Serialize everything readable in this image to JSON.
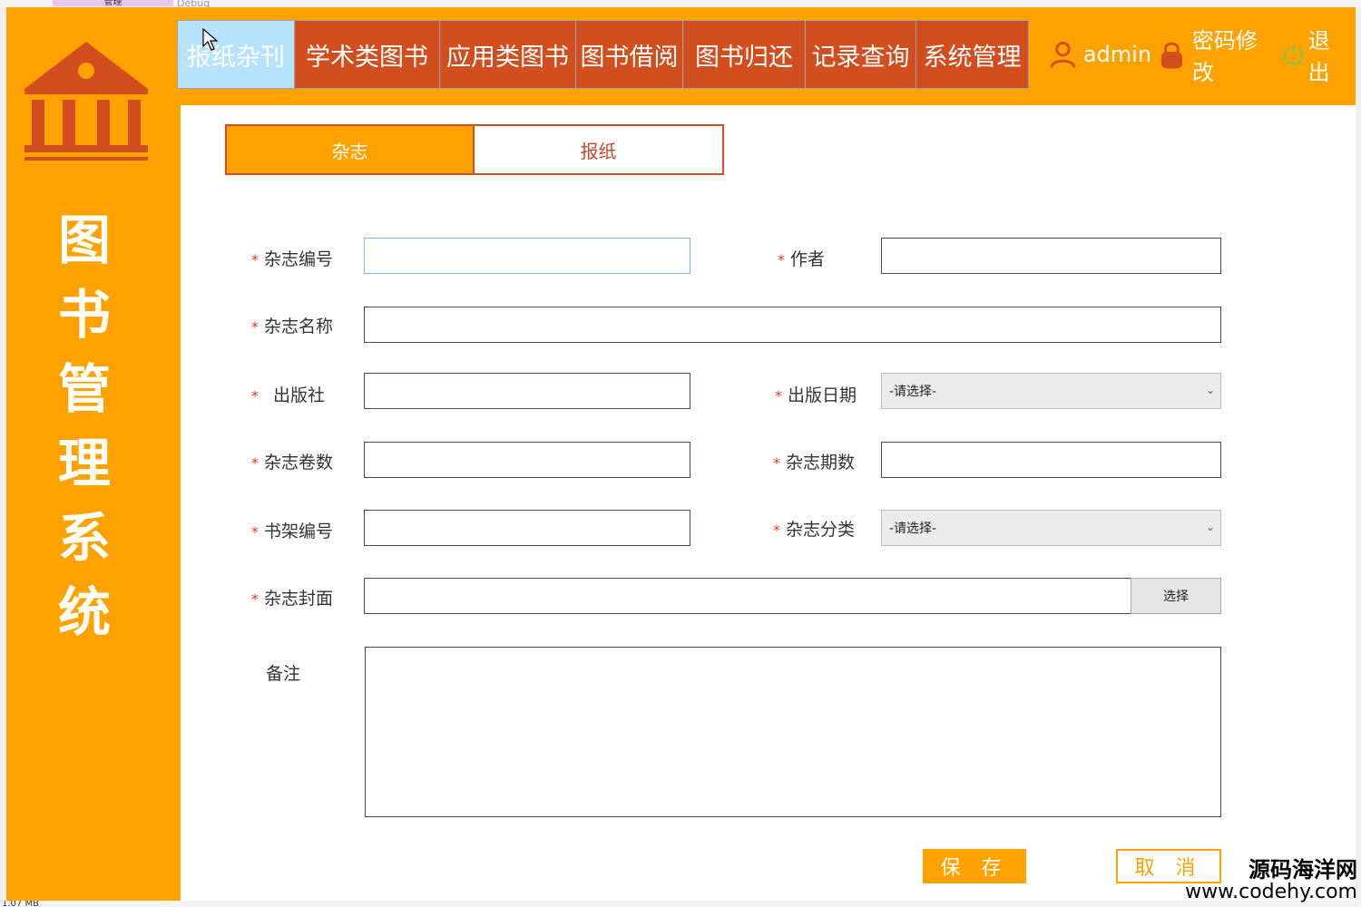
{
  "host": {
    "tab_label": "管理",
    "debug_label": "Debug",
    "status_size": "1.07 MB"
  },
  "sidebar": {
    "logo_icon": "library-building-icon",
    "title_chars": [
      "图",
      "书",
      "管",
      "理",
      "系",
      "统"
    ]
  },
  "nav": {
    "items": [
      {
        "label": "报纸杂刊",
        "active": true
      },
      {
        "label": "学术类图书",
        "active": false
      },
      {
        "label": "应用类图书",
        "active": false
      },
      {
        "label": "图书借阅",
        "active": false
      },
      {
        "label": "图书归还",
        "active": false
      },
      {
        "label": "记录查询",
        "active": false
      },
      {
        "label": "系统管理",
        "active": false
      }
    ]
  },
  "userbar": {
    "user_icon": "user-icon",
    "username": "admin",
    "lock_icon": "lock-icon",
    "change_password": "密码修改",
    "power_icon": "power-icon",
    "logout": "退出"
  },
  "subtabs": {
    "magazine": "杂志",
    "newspaper": "报纸"
  },
  "form": {
    "required_mark": "*",
    "magazine_no": {
      "label": "杂志编号",
      "value": ""
    },
    "author": {
      "label": "作者",
      "value": ""
    },
    "magazine_name": {
      "label": "杂志名称",
      "value": ""
    },
    "publisher": {
      "label": "出版社",
      "value": ""
    },
    "publish_date": {
      "label": "出版日期",
      "selected": "-请选择-"
    },
    "volume": {
      "label": "杂志卷数",
      "value": ""
    },
    "issue": {
      "label": "杂志期数",
      "value": ""
    },
    "shelf_no": {
      "label": "书架编号",
      "value": ""
    },
    "category": {
      "label": "杂志分类",
      "selected": "-请选择-"
    },
    "cover": {
      "label": "杂志封面",
      "value": "",
      "button": "选择"
    },
    "remark": {
      "label": "备注",
      "value": ""
    },
    "save": "保 存",
    "cancel": "取 消"
  },
  "watermark": {
    "line1": "源码海洋网",
    "line2": "www.codehy.com"
  },
  "colors": {
    "frame": "#ffa200",
    "nav": "#d24e1e",
    "nav_active": "#b6e2fb",
    "required": "#e23b2b"
  }
}
